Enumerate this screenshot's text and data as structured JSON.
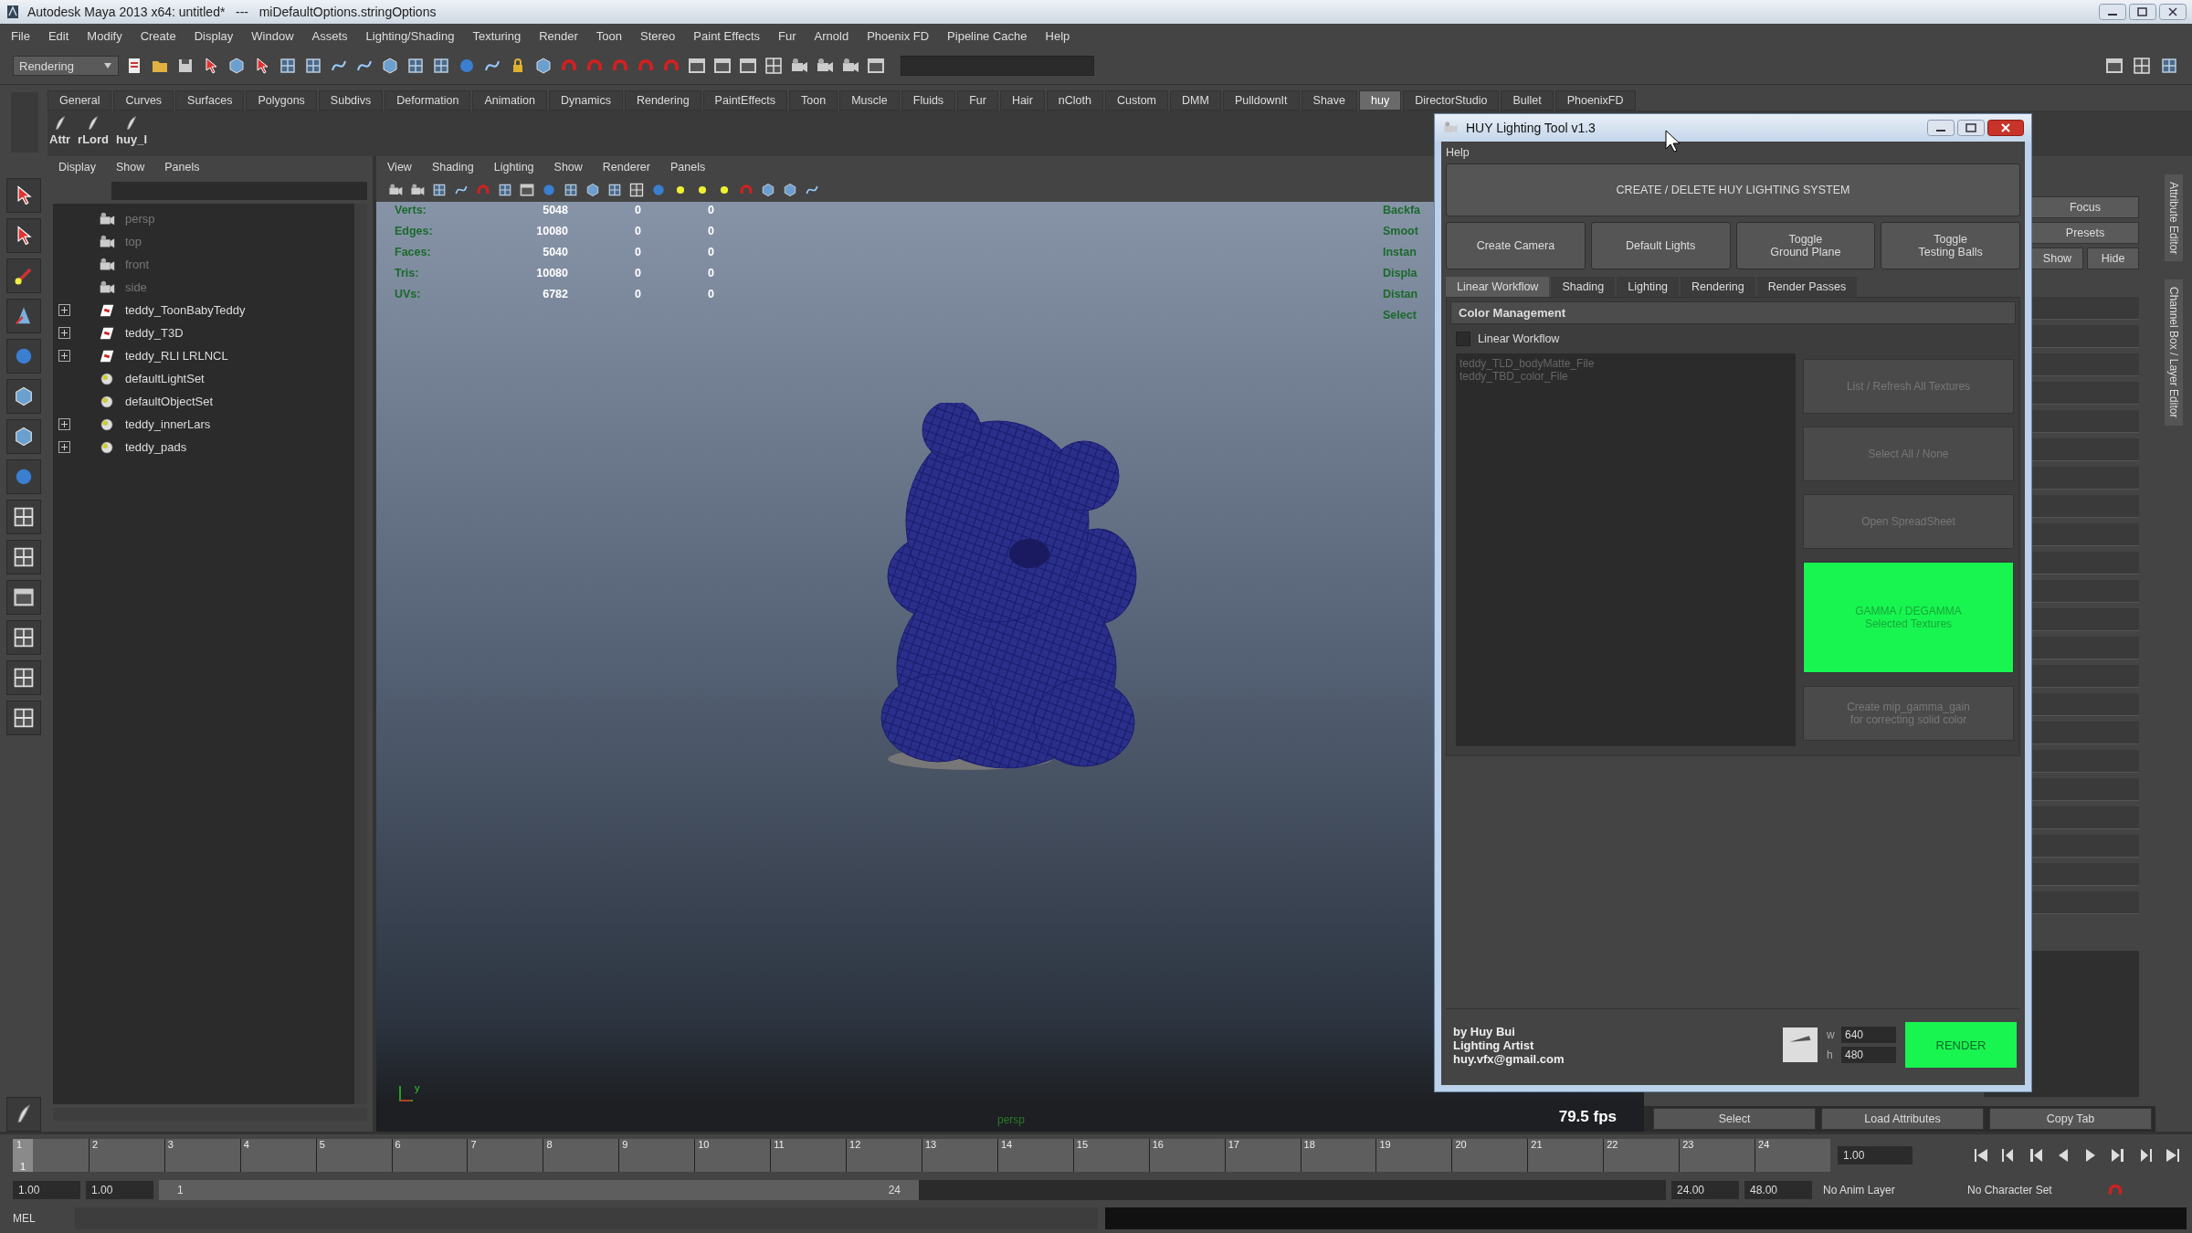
{
  "window": {
    "title": "Autodesk Maya 2013 x64: untitled*   ---   miDefaultOptions.stringOptions"
  },
  "menu_bar": [
    "File",
    "Edit",
    "Modify",
    "Create",
    "Display",
    "Window",
    "Assets",
    "Lighting/Shading",
    "Texturing",
    "Render",
    "Toon",
    "Stereo",
    "Paint Effects",
    "Fur",
    "Arnold",
    "Phoenix FD",
    "Pipeline Cache",
    "Help"
  ],
  "status_line": {
    "mode": "Rendering"
  },
  "shelf": {
    "tabs": [
      {
        "label": "General",
        "selected": false
      },
      {
        "label": "Curves",
        "selected": false
      },
      {
        "label": "Surfaces",
        "selected": false
      },
      {
        "label": "Polygons",
        "selected": false
      },
      {
        "label": "Subdivs",
        "selected": false
      },
      {
        "label": "Deformation",
        "selected": false
      },
      {
        "label": "Animation",
        "selected": false
      },
      {
        "label": "Dynamics",
        "selected": false
      },
      {
        "label": "Rendering",
        "selected": false
      },
      {
        "label": "PaintEffects",
        "selected": false
      },
      {
        "label": "Toon",
        "selected": false
      },
      {
        "label": "Muscle",
        "selected": false
      },
      {
        "label": "Fluids",
        "selected": false
      },
      {
        "label": "Fur",
        "selected": false
      },
      {
        "label": "Hair",
        "selected": false
      },
      {
        "label": "nCloth",
        "selected": false
      },
      {
        "label": "Custom",
        "selected": false
      },
      {
        "label": "DMM",
        "selected": false
      },
      {
        "label": "PulldownIt",
        "selected": false
      },
      {
        "label": "Shave",
        "selected": false
      },
      {
        "label": "huy",
        "selected": true
      },
      {
        "label": "DirectorStudio",
        "selected": false
      },
      {
        "label": "Bullet",
        "selected": false
      },
      {
        "label": "PhoenixFD",
        "selected": false
      }
    ],
    "buttons": [
      "Attr",
      "rLord",
      "huy_l"
    ]
  },
  "outliner": {
    "menu": [
      "Display",
      "Show",
      "Panels"
    ],
    "items": [
      {
        "label": "persp",
        "kind": "camera",
        "dimmed": true,
        "expandable": false
      },
      {
        "label": "top",
        "kind": "camera",
        "dimmed": true,
        "expandable": false
      },
      {
        "label": "front",
        "kind": "camera",
        "dimmed": true,
        "expandable": false
      },
      {
        "label": "side",
        "kind": "camera",
        "dimmed": true,
        "expandable": false
      },
      {
        "label": "teddy_ToonBabyTeddy",
        "kind": "transform",
        "dimmed": false,
        "expandable": true
      },
      {
        "label": "teddy_T3D",
        "kind": "transform",
        "dimmed": false,
        "expandable": true
      },
      {
        "label": "teddy_RLI LRLNCL",
        "kind": "transform",
        "dimmed": false,
        "expandable": true
      },
      {
        "label": "defaultLightSet",
        "kind": "set",
        "dimmed": false,
        "expandable": false
      },
      {
        "label": "defaultObjectSet",
        "kind": "set",
        "dimmed": false,
        "expandable": false
      },
      {
        "label": "teddy_innerLars",
        "kind": "set",
        "dimmed": false,
        "expandable": true
      },
      {
        "label": "teddy_pads",
        "kind": "set",
        "dimmed": false,
        "expandable": true
      }
    ]
  },
  "viewport": {
    "menu": [
      "View",
      "Shading",
      "Lighting",
      "Show",
      "Renderer",
      "Panels"
    ],
    "hud": [
      {
        "label": "Verts:",
        "values": [
          "5048",
          "0",
          "0"
        ]
      },
      {
        "label": "Edges:",
        "values": [
          "10080",
          "0",
          "0"
        ]
      },
      {
        "label": "Faces:",
        "values": [
          "5040",
          "0",
          "0"
        ]
      },
      {
        "label": "Tris:",
        "values": [
          "10080",
          "0",
          "0"
        ]
      },
      {
        "label": "UVs:",
        "values": [
          "6782",
          "0",
          "0"
        ]
      }
    ],
    "hud_right": [
      "Backfa",
      "Smoot",
      "Instan",
      "Displa",
      "Distan",
      "Select"
    ],
    "axis_label": "y",
    "camera_label": "persp",
    "fps": "79.5 fps"
  },
  "channel_box": {
    "buttons": [
      "Focus",
      "Presets"
    ],
    "toggle_buttons": [
      "Show",
      "Hide"
    ],
    "footer_buttons": [
      "Select",
      "Load Attributes",
      "Copy Tab"
    ],
    "side_tabs": [
      "Attribute Editor",
      "Channel Box / Layer Editor"
    ]
  },
  "tool_window": {
    "title": "HUY Lighting Tool v1.3",
    "menu": [
      "Help"
    ],
    "main_button": "CREATE / DELETE HUY LIGHTING SYSTEM",
    "buttons": [
      "Create Camera",
      "Default Lights",
      "Toggle\nGround Plane",
      "Toggle\nTesting Balls"
    ],
    "tabs": [
      {
        "label": "Linear Workflow",
        "selected": true
      },
      {
        "label": "Shading",
        "selected": false
      },
      {
        "label": "Lighting",
        "selected": false
      },
      {
        "label": "Rendering",
        "selected": false
      },
      {
        "label": "Render Passes",
        "selected": false
      }
    ],
    "section": "Color Management",
    "checkbox": {
      "label": "Linear Workflow",
      "checked": false
    },
    "textures": [
      "teddy_TLD_bodyMatte_File",
      "teddy_TBD_color_File"
    ],
    "actions": [
      {
        "label": "List / Refresh All Textures",
        "kind": "disabled"
      },
      {
        "label": "Select All / None",
        "kind": "disabled"
      },
      {
        "label": "Open SpreadSheet",
        "kind": "disabled"
      },
      {
        "label": "GAMMA / DEGAMMA\nSelected Textures",
        "kind": "accent"
      },
      {
        "label": "Create mip_gamma_gain\nfor correcting solid color",
        "kind": "disabled"
      }
    ],
    "credits": [
      "by Huy Bui",
      "Lighting Artist",
      "huy.vfx@gmail.com"
    ],
    "width": {
      "label": "w",
      "value": "640"
    },
    "height": {
      "label": "h",
      "value": "480"
    },
    "render_button": "RENDER"
  },
  "timeline": {
    "ticks": [
      "1",
      "2",
      "3",
      "4",
      "5",
      "6",
      "7",
      "8",
      "9",
      "10",
      "11",
      "12",
      "13",
      "14",
      "15",
      "16",
      "17",
      "18",
      "19",
      "20",
      "21",
      "22",
      "23",
      "24"
    ],
    "current_frame": "1",
    "level": 0,
    "frame_field": "1.00"
  },
  "range": {
    "start": "1.00",
    "playback_start": "1.00",
    "slider_start": "1",
    "slider_end": "24",
    "level": 0.48,
    "playback_end": "24.00",
    "end": "48.00",
    "anim_layer": "No Anim Layer",
    "character_set": "No Character Set"
  },
  "command_line": {
    "language": "MEL"
  }
}
